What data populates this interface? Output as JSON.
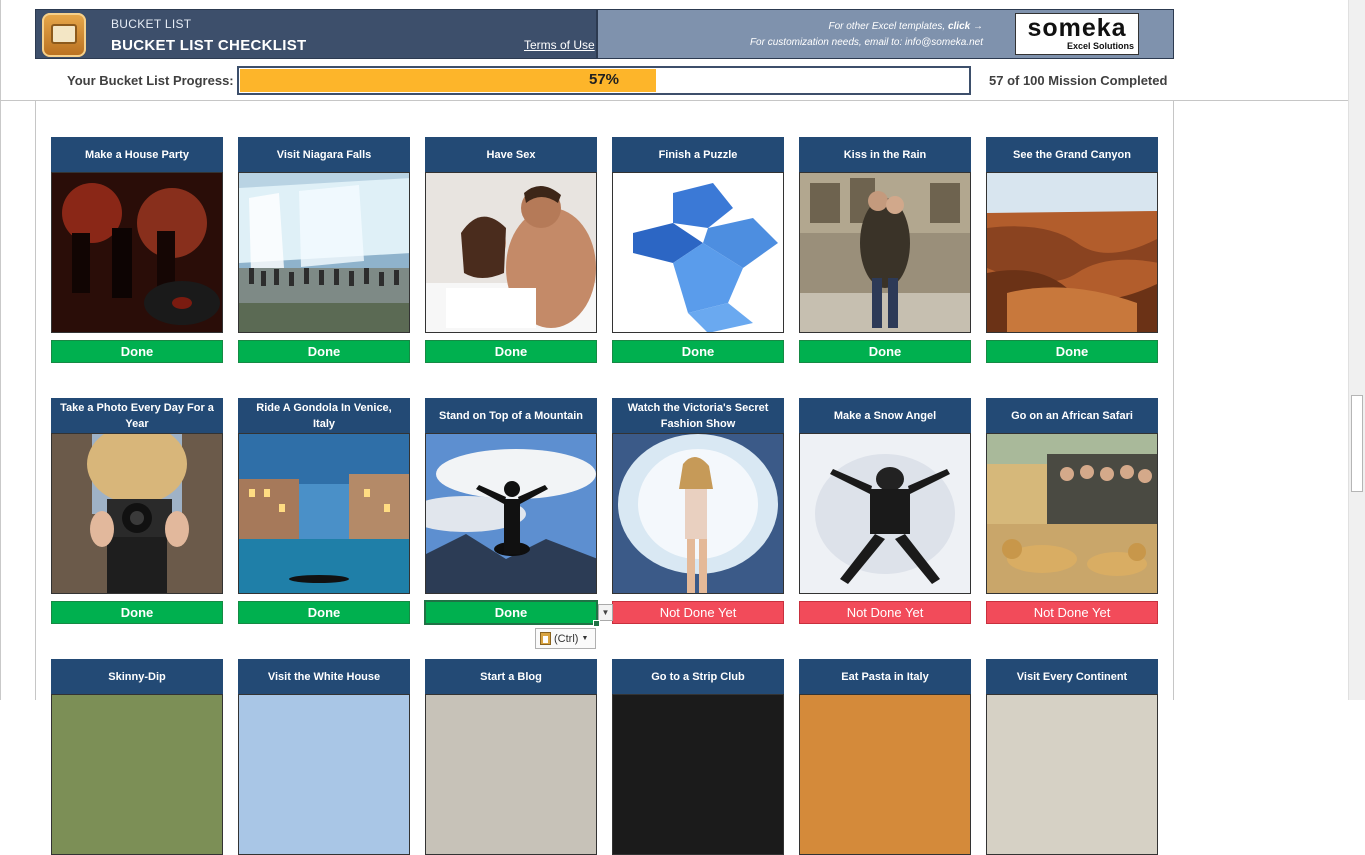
{
  "header": {
    "subtitle": "BUCKET LIST",
    "title": "BUCKET LIST CHECKLIST",
    "terms_link": "Terms of Use",
    "promo_line1_prefix": "For other Excel templates, ",
    "promo_line1_link": "click →",
    "promo_line2": "For customization needs, email to: info@someka.net",
    "brand_name": "someka",
    "brand_sub": "Excel Solutions"
  },
  "progress": {
    "label": "Your Bucket List Progress:",
    "percent_text": "57%",
    "fraction": 0.57,
    "count_text": "57 of 100 Mission Completed"
  },
  "colors": {
    "header_dark": "#3d4f6b",
    "header_light": "#7f92ad",
    "card_title": "#234a75",
    "done": "#00b04f",
    "not_done": "#f24b5a",
    "progress_fill": "#fdb52a"
  },
  "cards": [
    {
      "title": "Make a House Party",
      "status": "Done",
      "photo": "party-photo"
    },
    {
      "title": "Visit Niagara Falls",
      "status": "Done",
      "photo": "waterfall-photo"
    },
    {
      "title": "Have Sex",
      "status": "Done",
      "photo": "couple-photo"
    },
    {
      "title": "Finish a Puzzle",
      "status": "Done",
      "photo": "puzzle-photo"
    },
    {
      "title": "Kiss in the Rain",
      "status": "Done",
      "photo": "kiss-photo"
    },
    {
      "title": "See the Grand Canyon",
      "status": "Done",
      "photo": "canyon-photo"
    },
    {
      "title": "Take a Photo Every Day For a Year",
      "status": "Done",
      "photo": "camera-photo"
    },
    {
      "title": "Ride A Gondola In Venice, Italy",
      "status": "Done",
      "photo": "venice-photo"
    },
    {
      "title": "Stand on Top of a Mountain",
      "status": "Done",
      "photo": "mountain-photo"
    },
    {
      "title": "Watch the Victoria's Secret Fashion Show",
      "status": "Not Done Yet",
      "photo": "fashion-photo"
    },
    {
      "title": "Make a Snow Angel",
      "status": "Not Done Yet",
      "photo": "snow-photo"
    },
    {
      "title": "Go on an African Safari",
      "status": "Not Done Yet",
      "photo": "safari-photo"
    },
    {
      "title": "Skinny-Dip",
      "status": "",
      "photo": "lake-photo"
    },
    {
      "title": "Visit the White House",
      "status": "",
      "photo": "whitehouse-photo"
    },
    {
      "title": "Start a Blog",
      "status": "",
      "photo": "blog-photo"
    },
    {
      "title": "Go to a Strip Club",
      "status": "",
      "photo": "club-photo"
    },
    {
      "title": "Eat Pasta in Italy",
      "status": "",
      "photo": "pasta-photo"
    },
    {
      "title": "Visit Every Continent",
      "status": "",
      "photo": "globe-photo"
    }
  ],
  "paste_options": {
    "label": "(Ctrl)"
  }
}
